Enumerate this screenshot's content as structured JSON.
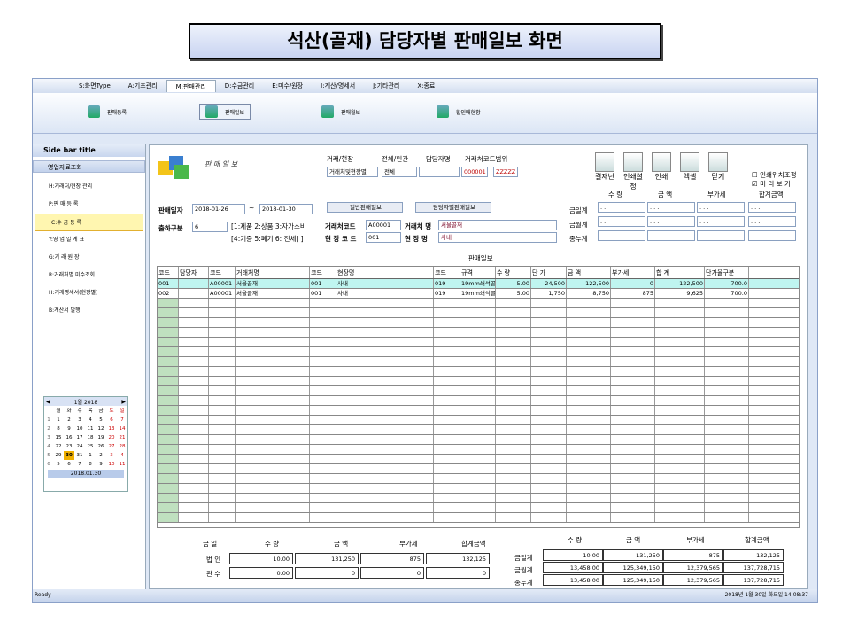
{
  "slide_title": "석산(골재) 담당자별 판매일보 화면",
  "menu": [
    {
      "label": "S:화면Type"
    },
    {
      "label": "A:기초관리"
    },
    {
      "label": "M:판매관리",
      "active": true
    },
    {
      "label": "D:수금관리"
    },
    {
      "label": "E:미수/원장"
    },
    {
      "label": "I:계산/명세서"
    },
    {
      "label": "J:기타관리"
    },
    {
      "label": "X:종료"
    }
  ],
  "ribbon": [
    "판매등록",
    "판매일보",
    "판매월보",
    "할인매현황"
  ],
  "sidebar": {
    "title": "Side bar title",
    "section": "영업자료조회",
    "items": [
      "H:거래처/현장 관리",
      "P:판 매 등 록",
      "C:수 금 등 록",
      "Y:영 업 일 계 표",
      "G:거 래 원 장",
      "R:거래처별 미수조회",
      "H:거래명세서(현장별)",
      "B:계산서 발행"
    ],
    "selected": 2
  },
  "calendar": {
    "month": "1월 2018",
    "weekdays": [
      "월",
      "화",
      "수",
      "목",
      "금",
      "토",
      "일"
    ],
    "weeks": [
      [
        "1",
        "1",
        "2",
        "3",
        "4",
        "5",
        "6",
        "7"
      ],
      [
        "2",
        "8",
        "9",
        "10",
        "11",
        "12",
        "13",
        "14"
      ],
      [
        "3",
        "15",
        "16",
        "17",
        "18",
        "19",
        "20",
        "21"
      ],
      [
        "4",
        "22",
        "23",
        "24",
        "25",
        "26",
        "27",
        "28"
      ],
      [
        "5",
        "29",
        "30",
        "31",
        "1",
        "2",
        "3",
        "4"
      ],
      [
        "6",
        "5",
        "6",
        "7",
        "8",
        "9",
        "10",
        "11"
      ]
    ],
    "today": "2018.01.30"
  },
  "header": {
    "title": "판 매 일 보",
    "f1": "거래/현장",
    "f1v": "거래처및현장별",
    "f2": "전체/민관",
    "f2v": "전체",
    "f3": "담당자명",
    "f4": "거래처코드범위",
    "f4a": "000001",
    "f4b": "ZZZZZ"
  },
  "toolbar": [
    "결재난",
    "인쇄설정",
    "인쇄",
    "엑셀",
    "닫기"
  ],
  "checks": [
    "인쇄위치조정",
    "미 리 보 기"
  ],
  "filters": {
    "date_label": "판매일자",
    "date_from": "2018-01-26",
    "date_to": "2018-01-30",
    "btn1": "일반판매일보",
    "btn2": "담당자별판매일보",
    "ship_label": "출하구분",
    "ship_value": "6",
    "ship_hint1": "[1:제품 2:상품 3:자가소비",
    "ship_hint2": "[4:기증 5:폐기 6: 전체] ]",
    "cust_code_label": "거래처코드",
    "cust_code": "A00001",
    "cust_name_label": "거래처 명",
    "cust_name": "서울골재",
    "site_code_label": "현 장 코 드",
    "site_code": "001",
    "site_name_label": "현 장 명",
    "site_name": "사내"
  },
  "summary_top": {
    "headers": [
      "수 량",
      "금 액",
      "부가세",
      "합계금액"
    ],
    "rows": [
      "금일계",
      "금월계",
      "종누계"
    ],
    "blank": [
      ". .",
      ". . .",
      ". . .",
      ". . ."
    ]
  },
  "grid_title": "판매일보",
  "grid_headers": [
    "코드",
    "담당자",
    "코드",
    "거래처명",
    "코드",
    "현장명",
    "코드",
    "규격",
    "수 량",
    "단 가",
    "금 액",
    "부가세",
    "합 계",
    "단가율구분"
  ],
  "grid_rows": [
    [
      "001",
      "",
      "A00001",
      "서울골재",
      "001",
      "사내",
      "019",
      "19mm쇄석골",
      "5.00",
      "24,500",
      "122,500",
      "0",
      "122,500",
      "700.0"
    ],
    [
      "002",
      "",
      "A00001",
      "서울골재",
      "001",
      "사내",
      "019",
      "19mm쇄석골",
      "5.00",
      "1,750",
      "8,750",
      "875",
      "9,625",
      "700.0"
    ]
  ],
  "bottom_left": {
    "headers": [
      "금 일",
      "수 량",
      "금 액",
      "부가세",
      "합계금액"
    ],
    "rows": [
      {
        "label": "법 인",
        "v": [
          "10.00",
          "131,250",
          "875",
          "132,125"
        ]
      },
      {
        "label": "관 수",
        "v": [
          "0.00",
          "0",
          "0",
          "0"
        ]
      }
    ]
  },
  "bottom_right": {
    "headers": [
      "수 량",
      "금 액",
      "부가세",
      "합계금액"
    ],
    "rows": [
      {
        "label": "금일계",
        "v": [
          "10.00",
          "131,250",
          "875",
          "132,125"
        ]
      },
      {
        "label": "금월계",
        "v": [
          "13,458.00",
          "125,349,150",
          "12,379,565",
          "137,728,715"
        ]
      },
      {
        "label": "종누계",
        "v": [
          "13,458.00",
          "125,349,150",
          "12,379,565",
          "137,728,715"
        ]
      }
    ]
  },
  "status": {
    "left": "Ready",
    "right": "2018년 1월 30일 화요일 14:08:37"
  }
}
